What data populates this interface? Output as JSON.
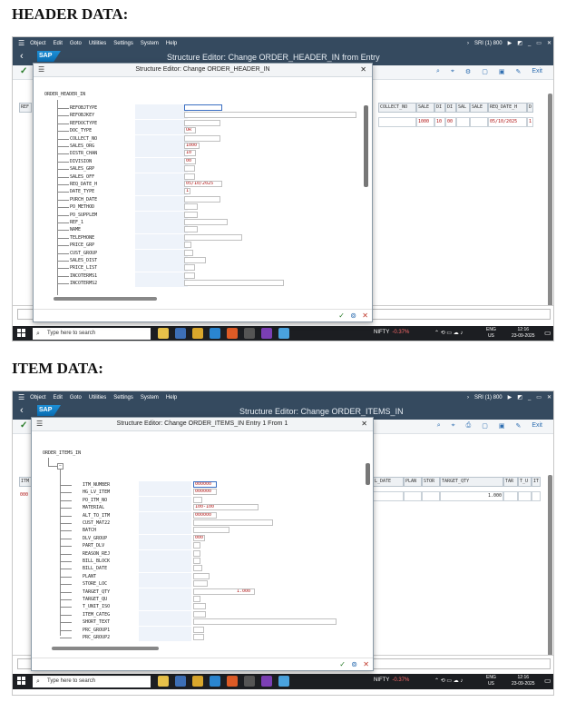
{
  "headings": {
    "header": "HEADER DATA:",
    "item": "ITEM DATA:"
  },
  "sap": {
    "menu": [
      "Object",
      "Edit",
      "Goto",
      "Utilities",
      "Settings",
      "System",
      "Help"
    ],
    "system": "SRI (1) 800",
    "logo": "SAP",
    "exit": "Exit",
    "header_title": "Structure Editor: Change ORDER_HEADER_IN from Entry",
    "items_title": "Structure Editor: Change ORDER_ITEMS_IN"
  },
  "header_grid": {
    "left_col": "REF",
    "columns": [
      "COLLECT_NO",
      "SALE",
      "DI",
      "DI",
      "SAL",
      "SALE",
      "REQ_DATE_H",
      "D"
    ],
    "values": [
      "",
      "1000",
      "10",
      "00",
      "",
      "",
      "05/10/2025",
      "1"
    ]
  },
  "header_dialog": {
    "title": "Structure Editor: Change ORDER_HEADER_IN",
    "root": "ORDER_HEADER_IN",
    "fields": [
      {
        "name": "REFOBJTYPE",
        "value": ""
      },
      {
        "name": "REFOBJKEY",
        "value": ""
      },
      {
        "name": "REFDOCTYPE",
        "value": ""
      },
      {
        "name": "DOC_TYPE",
        "value": "OR"
      },
      {
        "name": "COLLECT_NO",
        "value": ""
      },
      {
        "name": "SALES_ORG",
        "value": "1000"
      },
      {
        "name": "DISTR_CHAN",
        "value": "10"
      },
      {
        "name": "DIVISION",
        "value": "00"
      },
      {
        "name": "SALES_GRP",
        "value": ""
      },
      {
        "name": "SALES_OFF",
        "value": ""
      },
      {
        "name": "REQ_DATE_H",
        "value": "05/10/2025"
      },
      {
        "name": "DATE_TYPE",
        "value": "1"
      },
      {
        "name": "PURCH_DATE",
        "value": ""
      },
      {
        "name": "PO_METHOD",
        "value": ""
      },
      {
        "name": "PO_SUPPLEM",
        "value": ""
      },
      {
        "name": "REF_1",
        "value": ""
      },
      {
        "name": "NAME",
        "value": ""
      },
      {
        "name": "TELEPHONE",
        "value": ""
      },
      {
        "name": "PRICE_GRP",
        "value": ""
      },
      {
        "name": "CUST_GROUP",
        "value": ""
      },
      {
        "name": "SALES_DIST",
        "value": ""
      },
      {
        "name": "PRICE_LIST",
        "value": ""
      },
      {
        "name": "INCOTERMS1",
        "value": ""
      },
      {
        "name": "INCOTERMS2",
        "value": ""
      }
    ]
  },
  "item_grid": {
    "left_col": "ITM",
    "left_val": "000",
    "columns": [
      "L_DATE",
      "PLAN",
      "STOR",
      "TARGET_QTY",
      "TAR",
      "T_U",
      "IT"
    ],
    "values": [
      "",
      "",
      "",
      "1.000",
      "",
      "",
      ""
    ]
  },
  "item_dialog": {
    "title": "Structure Editor: Change ORDER_ITEMS_IN Entry 1 From 1",
    "root": "ORDER_ITEMS_IN",
    "fields": [
      {
        "name": "ITM_NUMBER",
        "value": "000000"
      },
      {
        "name": "HG_LV_ITEM",
        "value": "000000"
      },
      {
        "name": "PO_ITM_NO",
        "value": ""
      },
      {
        "name": "MATERIAL",
        "value": "100-100"
      },
      {
        "name": "ALT_TO_ITM",
        "value": "000000"
      },
      {
        "name": "CUST_MAT22",
        "value": ""
      },
      {
        "name": "BATCH",
        "value": ""
      },
      {
        "name": "DLV_GROUP",
        "value": "000"
      },
      {
        "name": "PART_DLV",
        "value": ""
      },
      {
        "name": "REASON_REJ",
        "value": ""
      },
      {
        "name": "BILL_BLOCK",
        "value": ""
      },
      {
        "name": "BILL_DATE",
        "value": ""
      },
      {
        "name": "PLANT",
        "value": ""
      },
      {
        "name": "STORE_LOC",
        "value": ""
      },
      {
        "name": "TARGET_QTY",
        "value": "1.000"
      },
      {
        "name": "TARGET_QU",
        "value": ""
      },
      {
        "name": "T_UNIT_ISO",
        "value": ""
      },
      {
        "name": "ITEM_CATEG",
        "value": ""
      },
      {
        "name": "SHORT_TEXT",
        "value": ""
      },
      {
        "name": "PRC_GROUP1",
        "value": ""
      },
      {
        "name": "PRC_GROUP2",
        "value": ""
      }
    ]
  },
  "taskbar": {
    "search": "Type here to search",
    "nifty": "NIFTY",
    "nifty_change": "-0.37%",
    "lang1": "ENG",
    "lang2": "US",
    "time": "12:16",
    "date": "23-09-2025"
  },
  "colors": {
    "shell": "#354a5f",
    "value_red": "#b01515",
    "taskbar": "#1c1e22"
  }
}
